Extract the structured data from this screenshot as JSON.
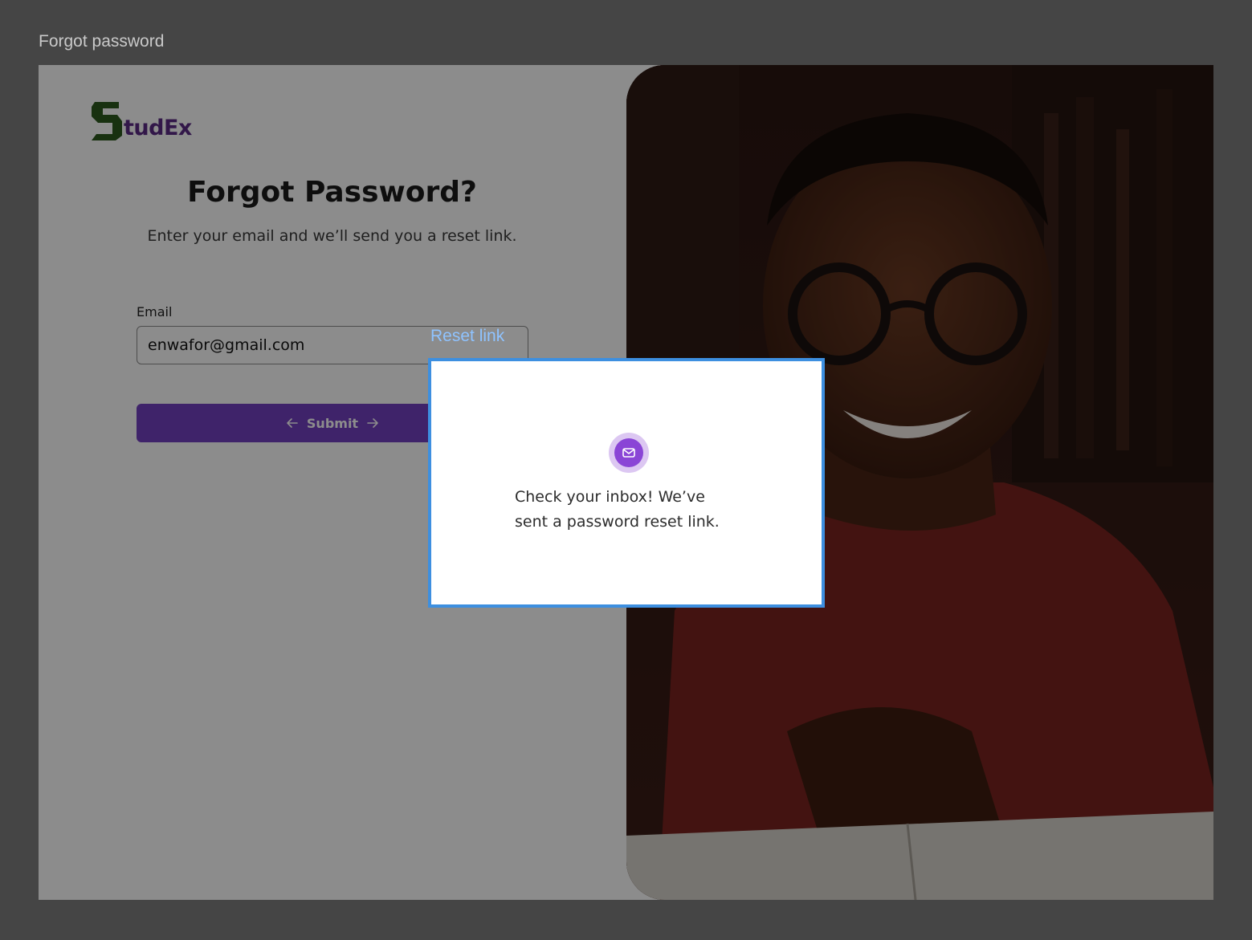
{
  "frame": {
    "title": "Forgot password"
  },
  "brand": {
    "name": "tudEx",
    "mark_color": "#2d5a1e",
    "text_color": "#5b2a86"
  },
  "form": {
    "title": "Forgot Password?",
    "subtitle": "Enter your email and we’ll send you a reset link.",
    "email_label": "Email",
    "email_value": "enwafor@gmail.com",
    "submit_label": "Submit",
    "accent": "#7340c2"
  },
  "modal": {
    "label": "Reset link",
    "icon": "mail-icon",
    "message_line1": "Check your inbox! We’ve",
    "message_line2": "sent a password reset link.",
    "border_color": "#3d8fe0"
  }
}
